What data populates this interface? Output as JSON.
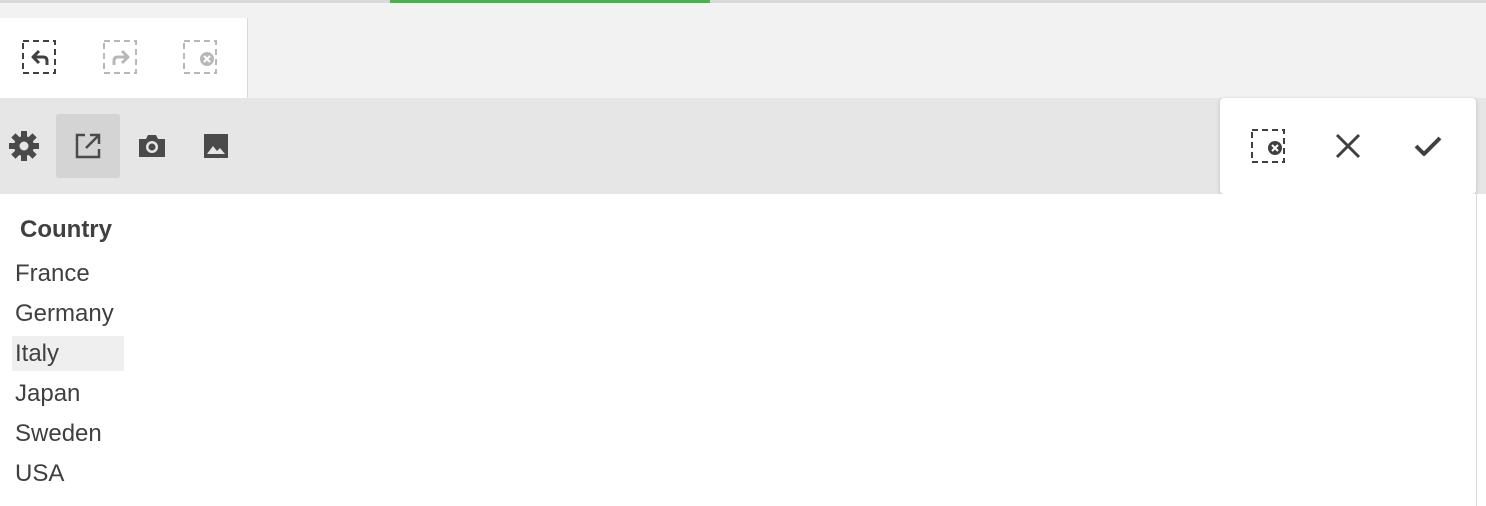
{
  "selection_toolbar": {
    "buttons": [
      {
        "name": "step-back",
        "icon": "selection-back-icon",
        "enabled": true
      },
      {
        "name": "step-forward",
        "icon": "selection-forward-icon",
        "enabled": false
      },
      {
        "name": "clear-all",
        "icon": "clear-selections-icon",
        "enabled": false
      }
    ]
  },
  "object_toolbar": {
    "buttons": [
      {
        "name": "settings",
        "icon": "gear-icon"
      },
      {
        "name": "expand",
        "icon": "open-external-icon",
        "active": true
      },
      {
        "name": "snapshot",
        "icon": "camera-icon"
      },
      {
        "name": "export-image",
        "icon": "image-icon"
      }
    ]
  },
  "confirm_bar": {
    "buttons": [
      {
        "name": "clear-selection",
        "icon": "clear-selection-icon"
      },
      {
        "name": "cancel",
        "icon": "close-icon"
      },
      {
        "name": "confirm",
        "icon": "checkmark-icon"
      }
    ]
  },
  "listbox": {
    "header": "Country",
    "items": [
      "France",
      "Germany",
      "Italy",
      "Japan",
      "Sweden",
      "USA"
    ],
    "hovered_item": "Italy"
  },
  "colors": {
    "accent": "#4caf50",
    "text": "#404040",
    "toolbar_bg": "#e6e6e6"
  }
}
